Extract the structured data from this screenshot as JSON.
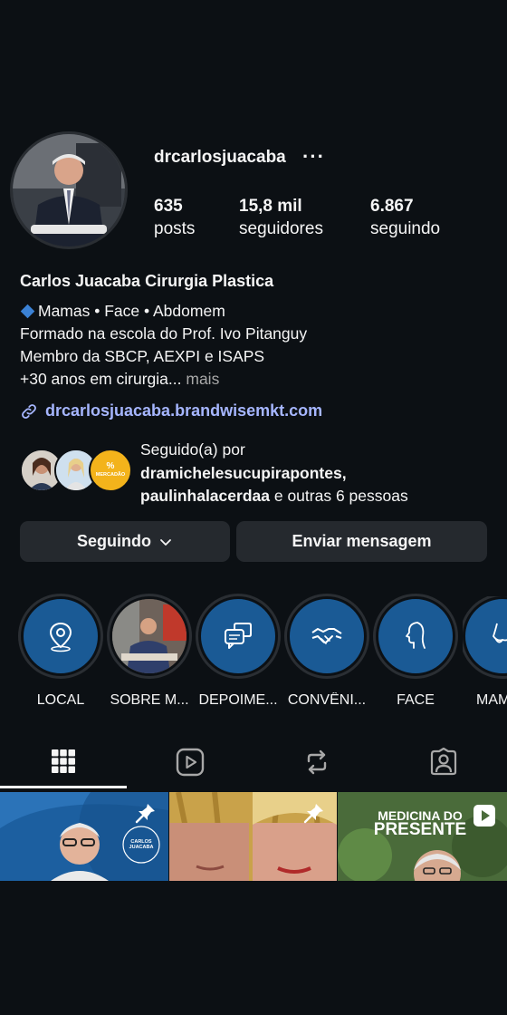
{
  "profile": {
    "username": "drcarlosjuacaba",
    "more_glyph": "···",
    "stats": [
      {
        "value": "635",
        "label": "posts"
      },
      {
        "value": "15,8 mil",
        "label": "seguidores"
      },
      {
        "value": "6.867",
        "label": "seguindo"
      }
    ],
    "display_name": "Carlos Juacaba Cirurgia Plastica",
    "bio_lines": [
      "Mamas • Face • Abdomem",
      "Formado na escola do Prof. Ivo Pitanguy",
      "Membro da SBCP, AEXPI e ISAPS",
      "+30 anos em cirurgia..."
    ],
    "bio_more": "mais",
    "link": "drcarlosjuacaba.brandwisemkt.com",
    "followed_by_prefix": "Seguido(a) por",
    "followed_by_user1": "dramichelesucupirapontes,",
    "followed_by_user2": "paulinhalacerdaa",
    "followed_by_suffix": "e outras 6 pessoas",
    "follower_badge_pct": "%",
    "follower_badge_text": "MERCADÃO"
  },
  "actions": {
    "following_label": "Seguindo",
    "message_label": "Enviar mensagem"
  },
  "highlights": [
    {
      "label": "LOCAL",
      "icon": "location-pin-icon"
    },
    {
      "label": "SOBRE M...",
      "icon": "photo"
    },
    {
      "label": "DEPOIME...",
      "icon": "chat-bubbles-icon"
    },
    {
      "label": "CONVÊNI...",
      "icon": "handshake-icon"
    },
    {
      "label": "FACE",
      "icon": "face-profile-icon"
    },
    {
      "label": "MAM",
      "icon": "body-icon"
    }
  ],
  "tabs": [
    "grid-icon",
    "reels-icon",
    "reposts-icon",
    "tagged-icon"
  ],
  "grid": {
    "post1_logo_text": "CARLOS JUACABA",
    "post3_title_line1": "MEDICINA DO",
    "post3_title_line2": "PRESENTE"
  },
  "colors": {
    "background": "#0c1014",
    "button_bg": "#25292e",
    "link": "#a6b6ff",
    "highlight_bg": "#1a5a95"
  }
}
